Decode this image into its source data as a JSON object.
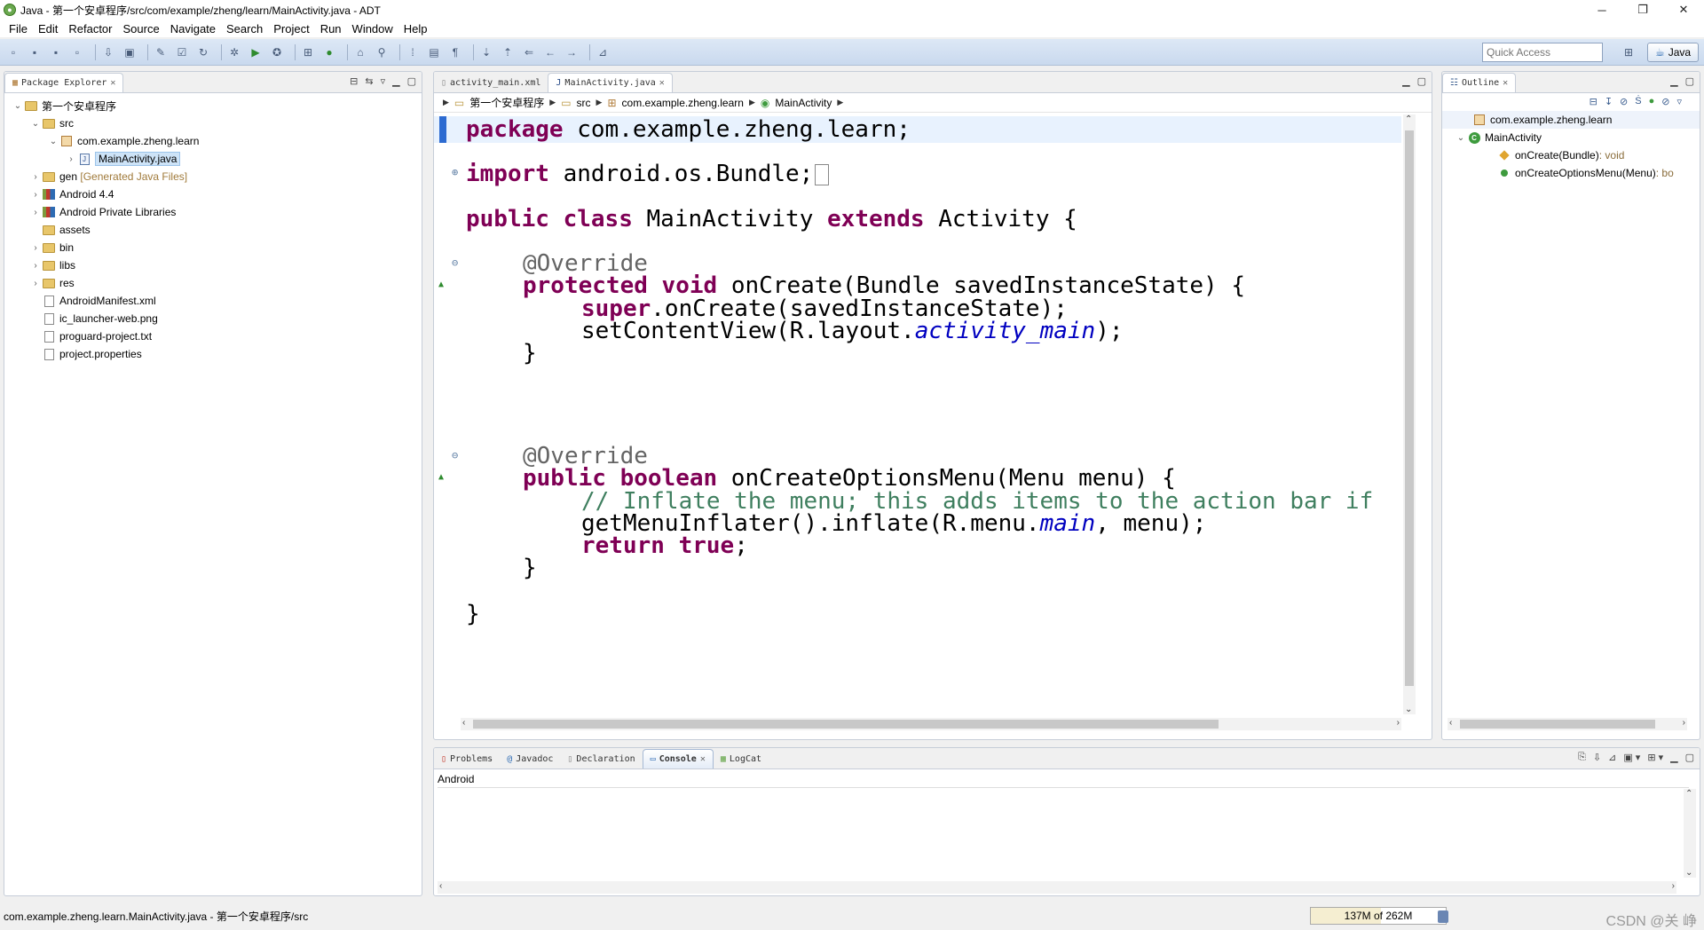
{
  "window": {
    "title": "Java - 第一个安卓程序/src/com/example/zheng/learn/MainActivity.java - ADT",
    "controls": [
      "─",
      "❐",
      "✕"
    ]
  },
  "menu": [
    "File",
    "Edit",
    "Refactor",
    "Source",
    "Navigate",
    "Search",
    "Project",
    "Run",
    "Window",
    "Help"
  ],
  "toolbar": {
    "quick_access_placeholder": "Quick Access",
    "perspective_label": "Java"
  },
  "package_explorer": {
    "tab_label": "Package Explorer",
    "items": [
      {
        "label": "第一个安卓程序",
        "arrow": "⌄",
        "icon": "project-icon"
      },
      {
        "label": "src",
        "arrow": "⌄",
        "icon": "folder-icon"
      },
      {
        "label": "com.example.zheng.learn",
        "arrow": "⌄",
        "icon": "package-icon"
      },
      {
        "label": "MainActivity.java",
        "arrow": "›",
        "icon": "java-file-icon",
        "selected": true
      },
      {
        "label": "gen",
        "note": "[Generated Java Files]",
        "arrow": "›",
        "icon": "folder-icon"
      },
      {
        "label": "Android 4.4",
        "arrow": "›",
        "icon": "library-icon"
      },
      {
        "label": "Android Private Libraries",
        "arrow": "›",
        "icon": "library-icon"
      },
      {
        "label": "assets",
        "arrow": "",
        "icon": "folder-icon"
      },
      {
        "label": "bin",
        "arrow": "›",
        "icon": "folder-icon"
      },
      {
        "label": "libs",
        "arrow": "›",
        "icon": "folder-icon"
      },
      {
        "label": "res",
        "arrow": "›",
        "icon": "folder-icon"
      },
      {
        "label": "AndroidManifest.xml",
        "arrow": "",
        "icon": "xml-file-icon"
      },
      {
        "label": "ic_launcher-web.png",
        "arrow": "",
        "icon": "image-file-icon"
      },
      {
        "label": "proguard-project.txt",
        "arrow": "",
        "icon": "text-file-icon"
      },
      {
        "label": "project.properties",
        "arrow": "",
        "icon": "text-file-icon"
      }
    ]
  },
  "editor": {
    "tabs": [
      {
        "label": "activity_main.xml",
        "active": false
      },
      {
        "label": "MainActivity.java",
        "active": true
      }
    ],
    "breadcrumb": [
      "第一个安卓程序",
      "src",
      "com.example.zheng.learn",
      "MainActivity"
    ],
    "code": {
      "l1_kw": "package",
      "l1_rest": " com.example.zheng.learn;",
      "l2_kw": "import",
      "l2_rest": " android.os.Bundle;",
      "l3_kw1": "public",
      "l3_kw2": "class",
      "l3_mid": " MainActivity ",
      "l3_kw3": "extends",
      "l3_rest": " Activity {",
      "l4": "@Override",
      "l5_kw1": "protected",
      "l5_kw2": "void",
      "l5_rest": " onCreate(Bundle savedInstanceState) {",
      "l6_kw": "super",
      "l6_rest": ".onCreate(savedInstanceState);",
      "l7_pre": "setContentView(R.layout.",
      "l7_fld": "activity_main",
      "l7_post": ");",
      "l8": "}",
      "l9": "@Override",
      "l10_kw1": "public",
      "l10_kw2": "boolean",
      "l10_rest": " onCreateOptionsMenu(Menu menu) {",
      "l11": "// Inflate the menu; this adds items to the action bar if",
      "l12_pre": "getMenuInflater().inflate(R.menu.",
      "l12_fld": "main",
      "l12_post": ", menu);",
      "l13_kw1": "return",
      "l13_kw2": "true",
      "l13_post": ";",
      "l14": "}",
      "l15": "}"
    }
  },
  "outline": {
    "tab_label": "Outline",
    "items": [
      {
        "label": "com.example.zheng.learn"
      },
      {
        "label": "MainActivity"
      },
      {
        "label": "onCreate(Bundle)",
        "ret": " : void"
      },
      {
        "label": "onCreateOptionsMenu(Menu)",
        "ret": " : bo"
      }
    ]
  },
  "console": {
    "tabs": [
      "Problems",
      "Javadoc",
      "Declaration",
      "Console",
      "LogCat"
    ],
    "active_tab": "Console",
    "title": "Android"
  },
  "status": {
    "text": "com.example.zheng.learn.MainActivity.java - 第一个安卓程序/src",
    "heap": "137M of 262M",
    "heap_used_fraction": 0.52,
    "watermark": "CSDN @关 峥"
  },
  "colors": {
    "keyword": "#7f0055",
    "field": "#0000c0",
    "comment": "#3f7f5f",
    "annotation": "#646464"
  }
}
